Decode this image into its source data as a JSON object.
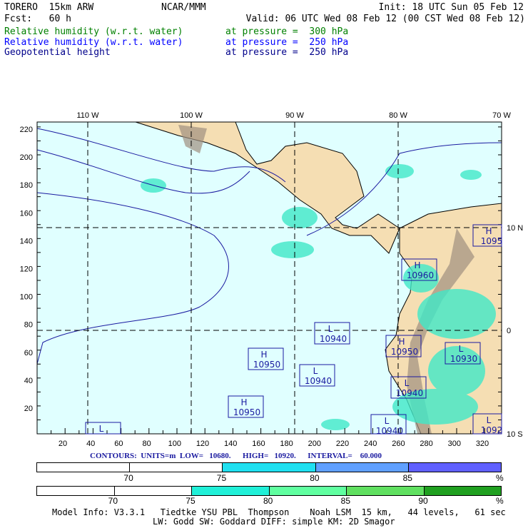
{
  "header": {
    "model": "TORERO  15km ARW",
    "org": "NCAR/MMM",
    "init": "Init: 18 UTC Sun 05 Feb 12",
    "fcst": "Fcst:   60 h",
    "valid": "Valid: 06 UTC Wed 08 Feb 12 (00 CST Wed 08 Feb 12)",
    "fields": [
      {
        "name": "Relative humidity (w.r.t. water)",
        "level": "at pressure =  300 hPa",
        "color": "#008000"
      },
      {
        "name": "Relative humidity (w.r.t. water)",
        "level": "at pressure =  250 hPa",
        "color": "#0000ff"
      },
      {
        "name": "Geopotential height",
        "level": "at pressure =  250 hPa",
        "color": "#00008b"
      }
    ]
  },
  "map": {
    "top_lon_labels": [
      "110 W",
      "100 W",
      "90 W",
      "80 W",
      "70 W"
    ],
    "right_lat_labels": [
      "10 N",
      "0",
      "10 S"
    ],
    "left_grid_labels": [
      "20",
      "40",
      "60",
      "80",
      "100",
      "120",
      "140",
      "160",
      "180",
      "200",
      "220"
    ],
    "bottom_grid_labels": [
      "20",
      "40",
      "60",
      "80",
      "100",
      "120",
      "140",
      "160",
      "180",
      "200",
      "220",
      "240",
      "260",
      "280",
      "300",
      "320"
    ],
    "centers": [
      {
        "type": "H",
        "value": "10960"
      },
      {
        "type": "H",
        "value": "10950"
      },
      {
        "type": "L",
        "value": "10940"
      },
      {
        "type": "L",
        "value": "10940"
      },
      {
        "type": "H",
        "value": "10950"
      },
      {
        "type": "H",
        "value": "10950"
      },
      {
        "type": "L",
        "value": "10930"
      },
      {
        "type": "L",
        "value": "10940"
      },
      {
        "type": "L",
        "value": "10940"
      },
      {
        "type": "H",
        "value": "1095"
      },
      {
        "type": "L",
        "value": "1092"
      },
      {
        "type": "L",
        "value": ""
      }
    ]
  },
  "contours": "CONTOURS:  UNITS=m  LOW=   10680.      HIGH=   10920.      INTERVAL=    60.000",
  "colorbar_250": {
    "colors": [
      "#ffffff",
      "#ffffff",
      "#20e0f0",
      "#60a0ff",
      "#6060ff"
    ],
    "labels": [
      "70",
      "75",
      "80",
      "85",
      "%"
    ]
  },
  "colorbar_300": {
    "colors": [
      "#ffffff",
      "#ffffff",
      "#20f0d8",
      "#60ffa0",
      "#60e060",
      "#20a020"
    ],
    "labels": [
      "70",
      "75",
      "80",
      "85",
      "90",
      "%"
    ]
  },
  "footer": {
    "line1": "Model Info: V3.3.1   Tiedtke YSU PBL  Thompson    Noah LSM  15 km,   44 levels,   61 sec",
    "line2": "LW: Godd SW: Goddard DIFF: simple KM: 2D Smagor"
  }
}
